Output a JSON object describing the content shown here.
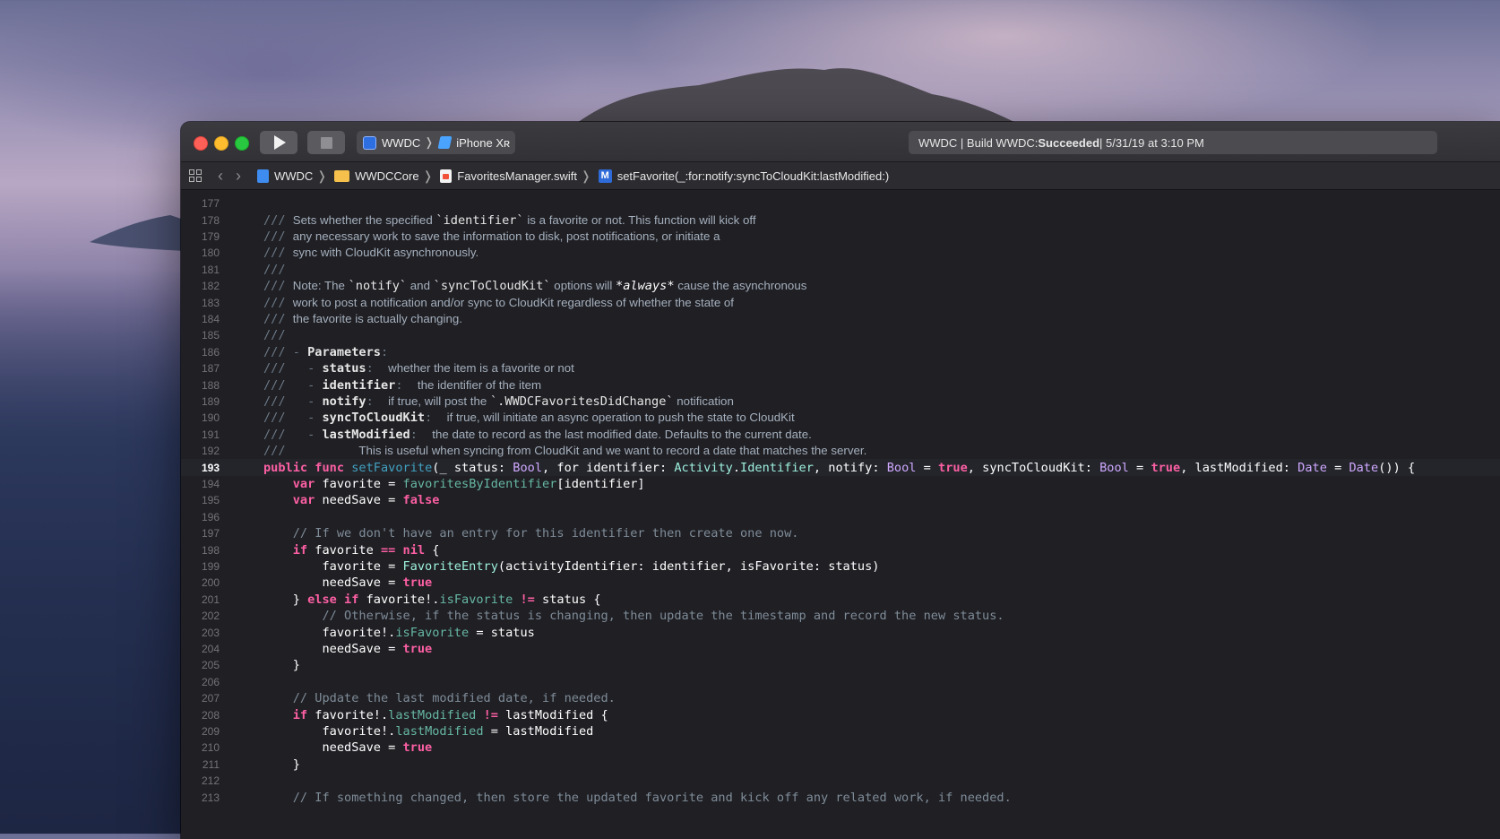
{
  "window": {
    "scheme_target": "WWDC",
    "scheme_device": "iPhone Xʀ",
    "activity_prefix": "WWDC | Build WWDC: ",
    "activity_status": "Succeeded",
    "activity_suffix": " | 5/31/19 at 3:10 PM"
  },
  "breadcrumbs": [
    "WWDC",
    "WWDCCore",
    "FavoritesManager.swift",
    "setFavorite(_:for:notify:syncToCloudKit:lastModified:)"
  ],
  "editor": {
    "current_line": 193,
    "lines": [
      {
        "n": "177",
        "tokens": []
      },
      {
        "n": "178",
        "tokens": [
          [
            "doc",
            "/// "
          ],
          [
            "doc-text",
            "Sets whether the specified "
          ],
          [
            "doc-code",
            "`identifier`"
          ],
          [
            "doc-text",
            " is a favorite or not. This function will kick off"
          ]
        ]
      },
      {
        "n": "179",
        "tokens": [
          [
            "doc",
            "/// "
          ],
          [
            "doc-text",
            "any necessary work to save the information to disk, post notifications, or initiate a"
          ]
        ]
      },
      {
        "n": "180",
        "tokens": [
          [
            "doc",
            "/// "
          ],
          [
            "doc-text",
            "sync with CloudKit asynchronously."
          ]
        ]
      },
      {
        "n": "181",
        "tokens": [
          [
            "doc",
            "///"
          ]
        ]
      },
      {
        "n": "182",
        "tokens": [
          [
            "doc",
            "/// "
          ],
          [
            "doc-text",
            "Note: The "
          ],
          [
            "doc-code",
            "`notify`"
          ],
          [
            "doc-text",
            " and "
          ],
          [
            "doc-code",
            "`syncToCloudKit`"
          ],
          [
            "doc-text",
            " options will "
          ],
          [
            "doc-em",
            "*always*"
          ],
          [
            "doc-text",
            " cause the asynchronous"
          ]
        ]
      },
      {
        "n": "183",
        "tokens": [
          [
            "doc",
            "/// "
          ],
          [
            "doc-text",
            "work to post a notification and/or sync to CloudKit regardless of whether the state of"
          ]
        ]
      },
      {
        "n": "184",
        "tokens": [
          [
            "doc",
            "/// "
          ],
          [
            "doc-text",
            "the favorite is actually changing."
          ]
        ]
      },
      {
        "n": "185",
        "tokens": [
          [
            "doc",
            "///"
          ]
        ]
      },
      {
        "n": "186",
        "tokens": [
          [
            "doc",
            "/// - "
          ],
          [
            "doc-bold",
            "Parameters"
          ],
          [
            "doc",
            ":"
          ]
        ]
      },
      {
        "n": "187",
        "tokens": [
          [
            "doc",
            "///   - "
          ],
          [
            "doc-bold",
            "status"
          ],
          [
            "doc",
            ":  "
          ],
          [
            "doc-text",
            "whether the item is a favorite or not"
          ]
        ]
      },
      {
        "n": "188",
        "tokens": [
          [
            "doc",
            "///   - "
          ],
          [
            "doc-bold",
            "identifier"
          ],
          [
            "doc",
            ":  "
          ],
          [
            "doc-text",
            "the identifier of the item"
          ]
        ]
      },
      {
        "n": "189",
        "tokens": [
          [
            "doc",
            "///   - "
          ],
          [
            "doc-bold",
            "notify"
          ],
          [
            "doc",
            ":  "
          ],
          [
            "doc-text",
            "if true, will post the "
          ],
          [
            "doc-code",
            "`.WWDCFavoritesDidChange`"
          ],
          [
            "doc-text",
            " notification"
          ]
        ]
      },
      {
        "n": "190",
        "tokens": [
          [
            "doc",
            "///   - "
          ],
          [
            "doc-bold",
            "syncToCloudKit"
          ],
          [
            "doc",
            ":  "
          ],
          [
            "doc-text",
            "if true, will initiate an async operation to push the state to CloudKit"
          ]
        ]
      },
      {
        "n": "191",
        "tokens": [
          [
            "doc",
            "///   - "
          ],
          [
            "doc-bold",
            "lastModified"
          ],
          [
            "doc",
            ":  "
          ],
          [
            "doc-text",
            "the date to record as the last modified date. Defaults to the current date."
          ]
        ]
      },
      {
        "n": "192",
        "tokens": [
          [
            "doc",
            "///          "
          ],
          [
            "doc-text",
            "This is useful when syncing from CloudKit and we want to record a date that matches the server."
          ]
        ]
      },
      {
        "n": "193",
        "tokens": [
          [
            "kw",
            "public"
          ],
          [
            "plain",
            " "
          ],
          [
            "kw",
            "func"
          ],
          [
            "plain",
            " "
          ],
          [
            "fn-decl",
            "setFavorite"
          ],
          [
            "plain",
            "(_ status: "
          ],
          [
            "type",
            "Bool"
          ],
          [
            "plain",
            ", for identifier: "
          ],
          [
            "proj-type",
            "Activity"
          ],
          [
            "plain",
            "."
          ],
          [
            "proj-type",
            "Identifier"
          ],
          [
            "plain",
            ", notify: "
          ],
          [
            "type",
            "Bool"
          ],
          [
            "plain",
            " = "
          ],
          [
            "kw",
            "true"
          ],
          [
            "plain",
            ", syncToCloudKit: "
          ],
          [
            "type",
            "Bool"
          ],
          [
            "plain",
            " = "
          ],
          [
            "kw",
            "true"
          ],
          [
            "plain",
            ", lastModified: "
          ],
          [
            "type",
            "Date"
          ],
          [
            "plain",
            " = "
          ],
          [
            "type",
            "Date"
          ],
          [
            "plain",
            "()) {"
          ]
        ]
      },
      {
        "n": "194",
        "tokens": [
          [
            "plain",
            "    "
          ],
          [
            "kw",
            "var"
          ],
          [
            "plain",
            " favorite = "
          ],
          [
            "proj-member",
            "favoritesByIdentifier"
          ],
          [
            "plain",
            "[identifier]"
          ]
        ]
      },
      {
        "n": "195",
        "tokens": [
          [
            "plain",
            "    "
          ],
          [
            "kw",
            "var"
          ],
          [
            "plain",
            " needSave = "
          ],
          [
            "kw",
            "false"
          ]
        ]
      },
      {
        "n": "196",
        "tokens": []
      },
      {
        "n": "197",
        "tokens": [
          [
            "plain",
            "    "
          ],
          [
            "comment",
            "// If we don't have an entry for this identifier then create one now."
          ]
        ]
      },
      {
        "n": "198",
        "tokens": [
          [
            "plain",
            "    "
          ],
          [
            "kw",
            "if"
          ],
          [
            "plain",
            " favorite "
          ],
          [
            "kw",
            "=="
          ],
          [
            "plain",
            " "
          ],
          [
            "kw",
            "nil"
          ],
          [
            "plain",
            " {"
          ]
        ]
      },
      {
        "n": "199",
        "tokens": [
          [
            "plain",
            "        favorite = "
          ],
          [
            "proj-type",
            "FavoriteEntry"
          ],
          [
            "plain",
            "(activityIdentifier: identifier, isFavorite: status)"
          ]
        ]
      },
      {
        "n": "200",
        "tokens": [
          [
            "plain",
            "        needSave = "
          ],
          [
            "kw",
            "true"
          ]
        ]
      },
      {
        "n": "201",
        "tokens": [
          [
            "plain",
            "    } "
          ],
          [
            "kw",
            "else"
          ],
          [
            "plain",
            " "
          ],
          [
            "kw",
            "if"
          ],
          [
            "plain",
            " favorite!."
          ],
          [
            "proj-member",
            "isFavorite"
          ],
          [
            "plain",
            " "
          ],
          [
            "kw",
            "!="
          ],
          [
            "plain",
            " status {"
          ]
        ]
      },
      {
        "n": "202",
        "tokens": [
          [
            "plain",
            "        "
          ],
          [
            "comment",
            "// Otherwise, if the status is changing, then update the timestamp and record the new status."
          ]
        ]
      },
      {
        "n": "203",
        "tokens": [
          [
            "plain",
            "        favorite!."
          ],
          [
            "proj-member",
            "isFavorite"
          ],
          [
            "plain",
            " = status"
          ]
        ]
      },
      {
        "n": "204",
        "tokens": [
          [
            "plain",
            "        needSave = "
          ],
          [
            "kw",
            "true"
          ]
        ]
      },
      {
        "n": "205",
        "tokens": [
          [
            "plain",
            "    }"
          ]
        ]
      },
      {
        "n": "206",
        "tokens": []
      },
      {
        "n": "207",
        "tokens": [
          [
            "plain",
            "    "
          ],
          [
            "comment",
            "// Update the last modified date, if needed."
          ]
        ]
      },
      {
        "n": "208",
        "tokens": [
          [
            "plain",
            "    "
          ],
          [
            "kw",
            "if"
          ],
          [
            "plain",
            " favorite!."
          ],
          [
            "proj-member",
            "lastModified"
          ],
          [
            "plain",
            " "
          ],
          [
            "kw",
            "!="
          ],
          [
            "plain",
            " lastModified {"
          ]
        ]
      },
      {
        "n": "209",
        "tokens": [
          [
            "plain",
            "        favorite!."
          ],
          [
            "proj-member",
            "lastModified"
          ],
          [
            "plain",
            " = lastModified"
          ]
        ]
      },
      {
        "n": "210",
        "tokens": [
          [
            "plain",
            "        needSave = "
          ],
          [
            "kw",
            "true"
          ]
        ]
      },
      {
        "n": "211",
        "tokens": [
          [
            "plain",
            "    }"
          ]
        ]
      },
      {
        "n": "212",
        "tokens": []
      },
      {
        "n": "213",
        "tokens": [
          [
            "plain",
            "    "
          ],
          [
            "comment",
            "// If something changed, then store the updated favorite and kick off any related work, if needed."
          ]
        ]
      }
    ]
  },
  "colors": {
    "editor_bg": "#1f1f24",
    "keyword": "#fc5fa3",
    "comment": "#7f8c98",
    "type": "#d0a8ff",
    "project_type": "#9ef1dd",
    "project_member": "#67b7a4",
    "function_decl": "#41a1c0"
  }
}
